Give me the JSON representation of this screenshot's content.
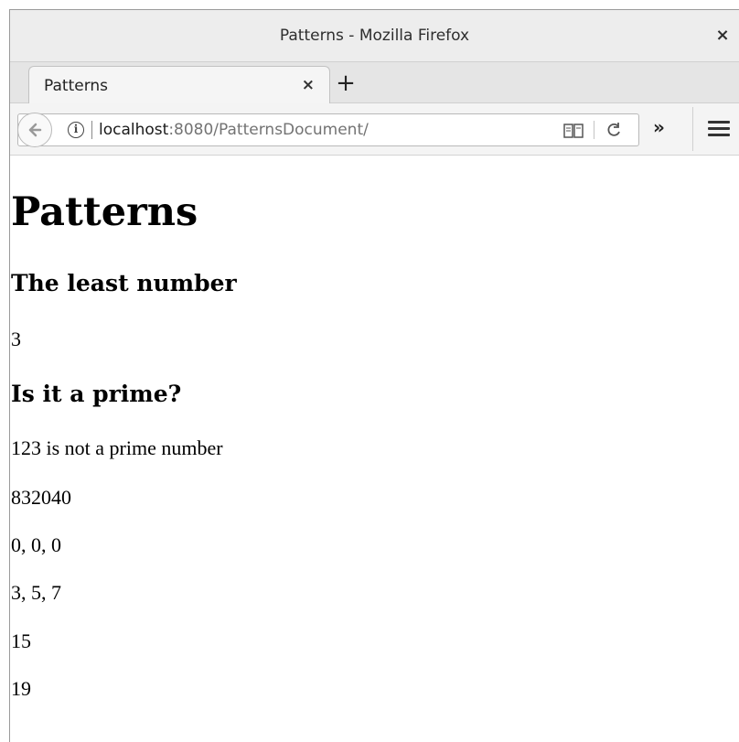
{
  "window": {
    "title": "Patterns - Mozilla Firefox",
    "close_glyph": "×"
  },
  "tabs": [
    {
      "label": "Patterns",
      "close_glyph": "×"
    }
  ],
  "new_tab_glyph": "+",
  "urlbar": {
    "host": "localhost",
    "rest": ":8080/PatternsDocument/"
  },
  "toolbar": {
    "overflow_glyph": "»"
  },
  "page": {
    "heading": "Patterns",
    "section1_heading": "The least number",
    "section1_value": "3",
    "section2_heading": "Is it a prime?",
    "lines": [
      "123 is not a prime number",
      "832040",
      "0, 0, 0",
      "3, 5, 7",
      "15",
      "19"
    ]
  }
}
